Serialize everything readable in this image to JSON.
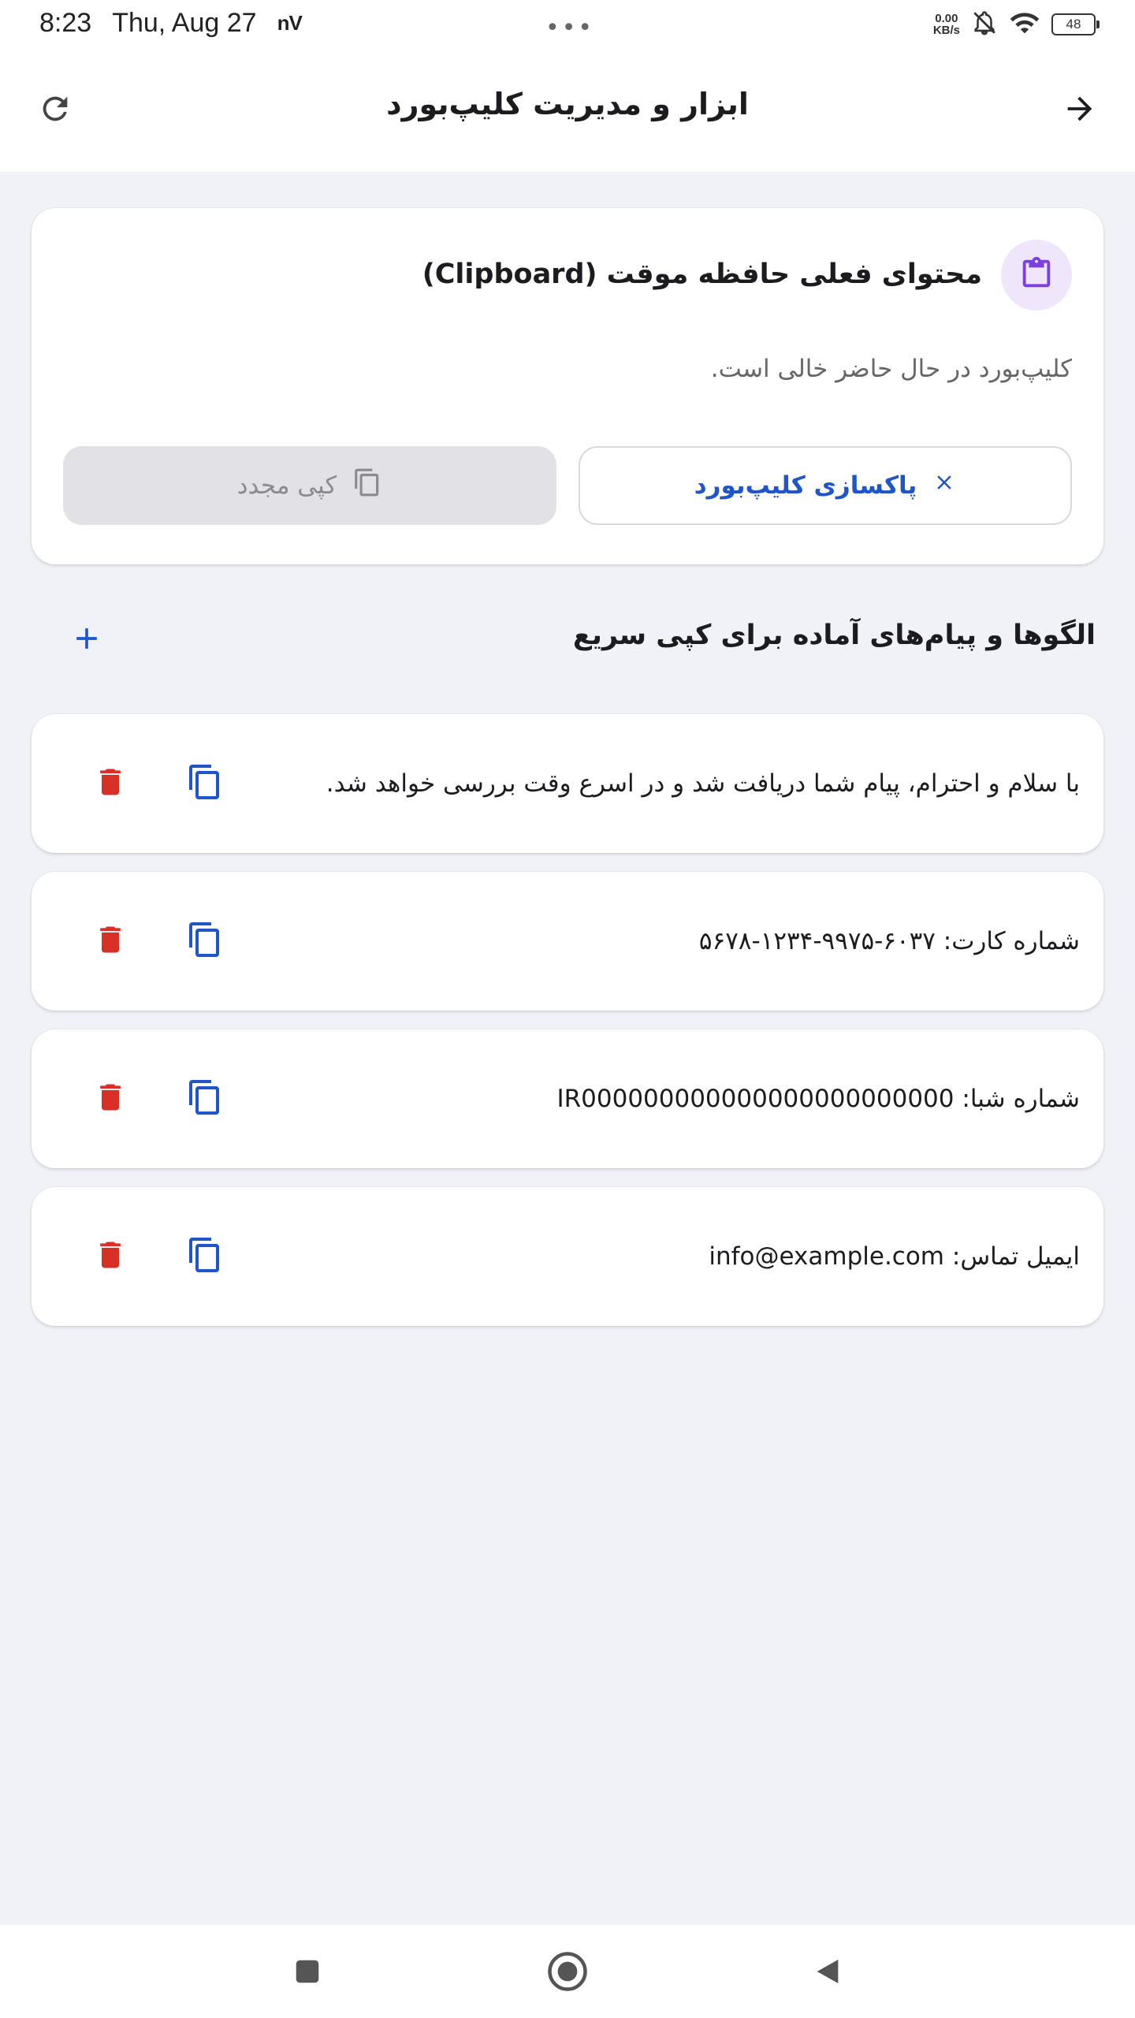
{
  "status_bar": {
    "time": "8:23",
    "date": "Thu, Aug 27",
    "carrier_badge": "nV",
    "net_speed_value": "0.00",
    "net_speed_unit": "KB/s",
    "battery": "48"
  },
  "app_bar": {
    "title": "ابزار و مدیریت کلیپ‌بورد",
    "refresh_icon": "refresh-icon",
    "back_icon": "arrow-forward-icon"
  },
  "clipboard_card": {
    "icon": "clipboard-icon",
    "title": "محتوای فعلی حافظه موقت (Clipboard)",
    "status_text": "کلیپ‌بورد در حال حاضر خالی است.",
    "clear_button_label": "پاکسازی کلیپ‌بورد",
    "recopy_button_label": "کپی مجدد"
  },
  "templates_section": {
    "title": "الگوها و پیام‌های آماده برای کپی سریع",
    "add_icon": "plus-icon",
    "items": [
      {
        "text": "با سلام و احترام، پیام شما دریافت شد و در اسرع وقت بررسی خواهد شد."
      },
      {
        "text": "شماره کارت: ۶۰۳۷-۹۹۷۵-۱۲۳۴-۵۶۷۸"
      },
      {
        "text": "شماره شبا: IR000000000000000000000000"
      },
      {
        "text": "ایمیل تماس: info@example.com"
      }
    ]
  },
  "colors": {
    "accent_blue": "#1e56c9",
    "delete_red": "#d93025",
    "clipboard_purple": "#7b3fe4",
    "background": "#f1f2f7"
  }
}
